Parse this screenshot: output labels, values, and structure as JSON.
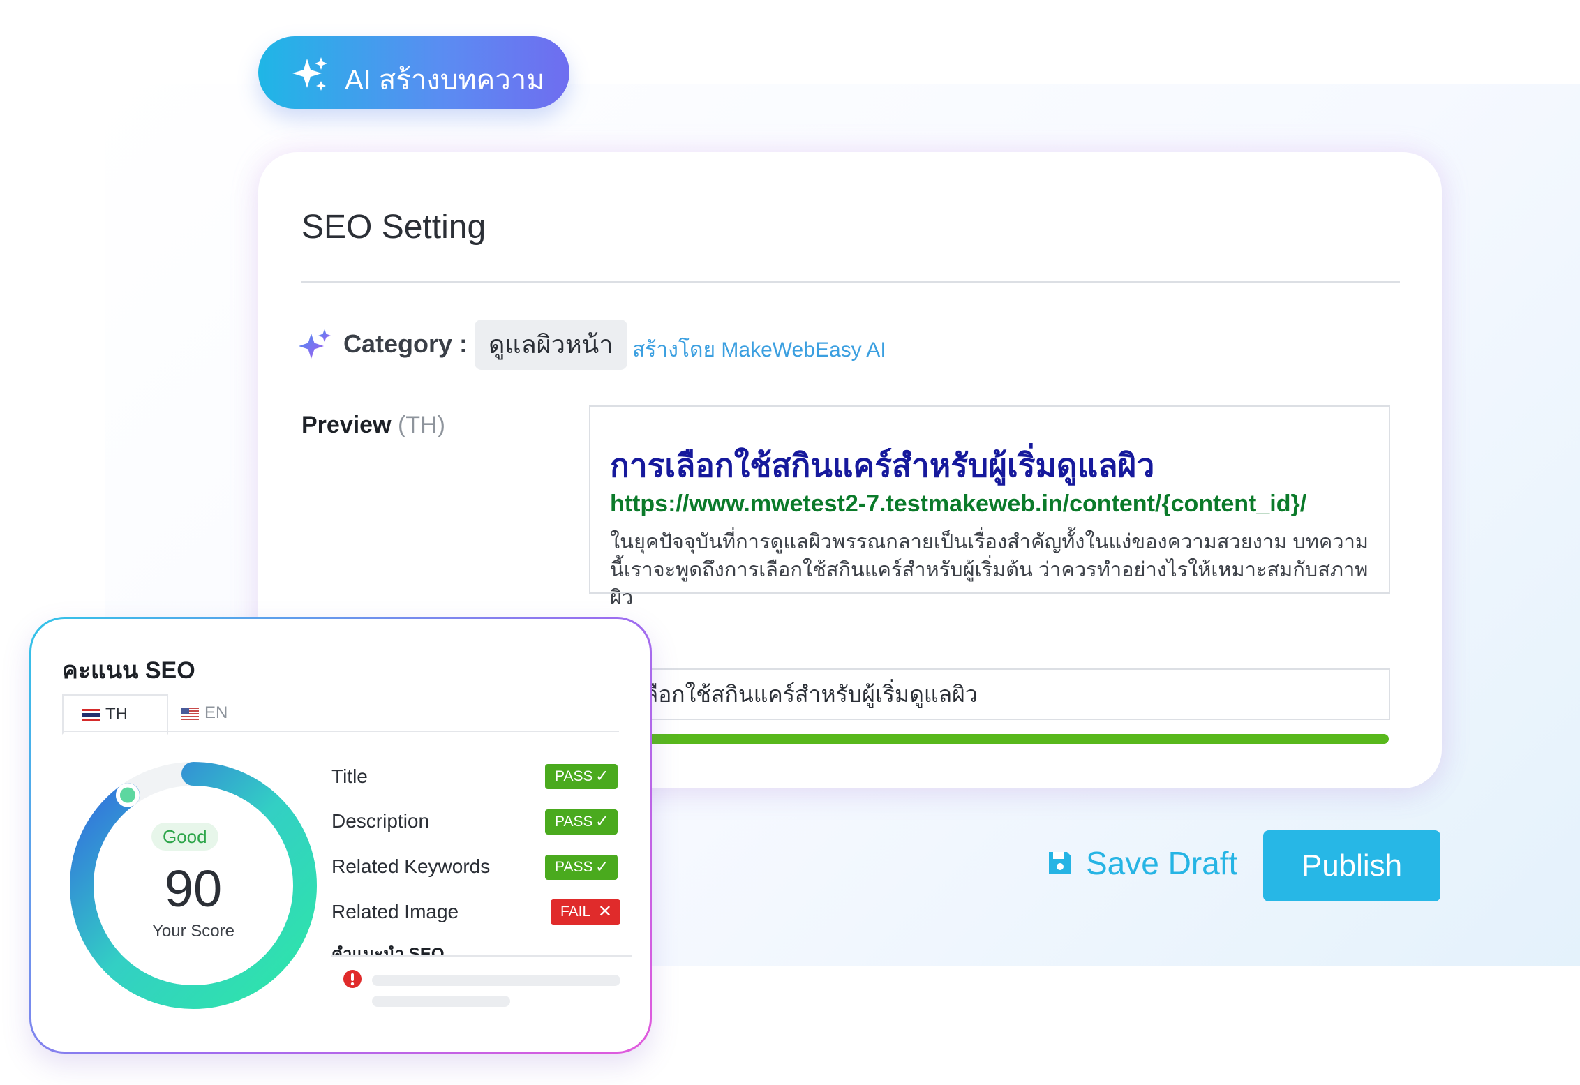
{
  "ai_button": {
    "label": "AI สร้างบทความ"
  },
  "seo_setting": {
    "title": "SEO Setting",
    "category_label": "Category :",
    "category_value": "ดูแลผิวหน้า",
    "category_ai_note": "สร้างโดย MakeWebEasy AI",
    "preview_label": "Preview",
    "preview_lang": "(TH)",
    "preview": {
      "title": "การเลือกใช้สกินแคร์สำหรับผู้เริ่มดูแลผิว",
      "url": "https://www.mwetest2-7.testmakeweb.in/content/{content_id}/",
      "description": "ในยุคปัจจุบันที่การดูแลผิวพรรณกลายเป็นเรื่องสำคัญทั้งในแง่ของความสวยงาม บทความนี้เราจะพูดถึงการเลือกใช้สกินแคร์สำหรับผู้เริ่มต้น ว่าควรทำอย่างไรให้เหมาะสมกับสภาพผิว"
    },
    "title_field_value": "การเลือกใช้สกินแคร์สำหรับผู้เริ่มดูแลผิว",
    "title_progress": 1.0
  },
  "actions": {
    "save_draft": "Save Draft",
    "publish": "Publish"
  },
  "seo_score": {
    "title": "คะแนน SEO",
    "tabs": [
      {
        "label": "TH"
      },
      {
        "label": "EN"
      }
    ],
    "rating": "Good",
    "score": "90",
    "score_value": 90,
    "score_label": "Your Score",
    "criteria": [
      {
        "name": "Title",
        "status": "PASS"
      },
      {
        "name": "Description",
        "status": "PASS"
      },
      {
        "name": "Related Keywords",
        "status": "PASS"
      },
      {
        "name": "Related Image",
        "status": "FAIL"
      }
    ],
    "tips_title": "คำแนะนำ SEO"
  },
  "colors": {
    "accent": "#27b7e6",
    "pass": "#4aaa1e",
    "fail": "#e02b2b",
    "preview_title": "#16199c",
    "preview_url": "#0b7a2a",
    "progress": "#58b81c"
  },
  "icons": {
    "ai": "sparkle-icon",
    "category": "sparkle-icon",
    "save": "floppy-disk-icon",
    "pass": "check-icon",
    "fail": "close-icon",
    "tip": "warning-icon"
  }
}
